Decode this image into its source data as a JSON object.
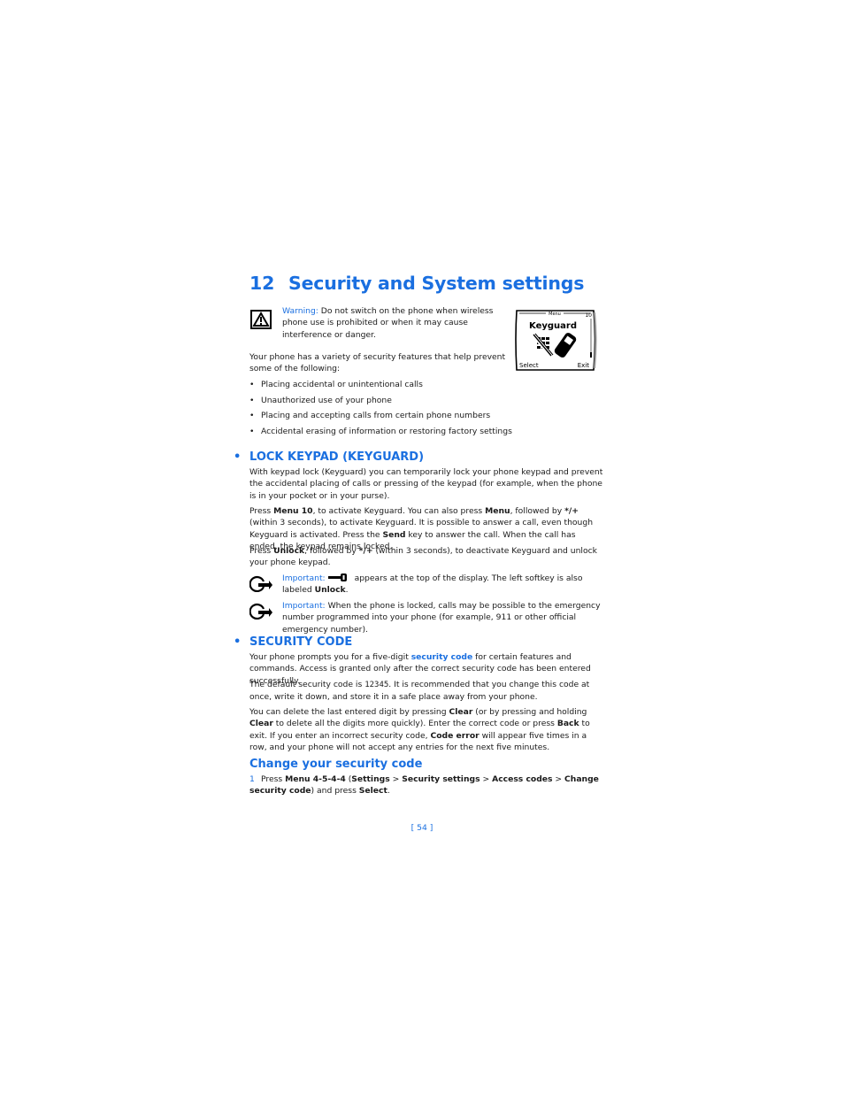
{
  "chapter": {
    "number": "12",
    "title": "Security and System settings"
  },
  "warning": {
    "icon": "warning-triangle-icon",
    "label": "Warning:",
    "text": " Do not switch on the phone when wireless phone use is prohibited or when it may cause interference or danger."
  },
  "phone_screen": {
    "header": "Menu",
    "index": "10",
    "title": "Keyguard",
    "left_softkey": "Select",
    "right_softkey": "Exit"
  },
  "intro": {
    "text": "Your phone has a variety of security features that help prevent some of the following:",
    "bullets": [
      "Placing accidental or unintentional calls",
      "Unauthorized use of your phone",
      "Placing and accepting calls from certain phone numbers",
      "Accidental erasing of information or restoring factory settings"
    ]
  },
  "lock_keypad": {
    "heading": "LOCK KEYPAD (KEYGUARD)",
    "p1": "With keypad lock (Keyguard) you can temporarily lock your phone keypad and prevent the accidental placing of calls or pressing of the keypad (for example, when the phone is in your pocket or in your purse).",
    "p2": {
      "t1": "Press ",
      "b1": "Menu 10",
      "t2": ", to activate Keyguard. You can also press ",
      "b2": "Menu",
      "t3": ", followed by ",
      "b3": "*/+",
      "t4": " (within 3 seconds), to activate Keyguard. It is possible to answer a call, even though Keyguard is activated. Press the ",
      "b4": "Send",
      "t5": " key to answer the call. When the call has ended, the keypad remains locked."
    },
    "p3": {
      "t1": "Press ",
      "b1": "Unlock",
      "t2": ", followed by ",
      "b2": "*/+",
      "t3": " (within 3 seconds), to deactivate Keyguard and unlock your phone keypad."
    },
    "note1": {
      "label": "Important:",
      "t1": " appears at the top of the display. The left softkey is also labeled ",
      "b1": "Unlock",
      "t2": "."
    },
    "note2": {
      "label": "Important:",
      "text": " When the phone is locked, calls may be possible to the emergency number programmed into your phone (for example, 911 or other official emergency number)."
    }
  },
  "security_code": {
    "heading": "SECURITY CODE",
    "p1": {
      "t1": "Your phone prompts you for a five-digit ",
      "link": "security code",
      "t2": " for certain features and commands. Access is granted only after the correct security code has been entered successfully."
    },
    "p2": {
      "t1": "The default security code is ",
      "code": "12345",
      "t2": ". It is recommended that you change this code at once, write it down, and store it in a safe place away from your phone."
    },
    "p3": {
      "t1": "You can delete the last entered digit by pressing ",
      "b1": "Clear",
      "t2": " (or by pressing and holding ",
      "b2": "Clear",
      "t3": " to delete all the digits more quickly). Enter the correct code or press ",
      "b3": "Back",
      "t4": " to exit. If you enter an incorrect security code, ",
      "b4": "Code error",
      "t5": " will appear five times in a row, and your phone will not accept any entries for the next five minutes."
    }
  },
  "change_code": {
    "heading": "Change your security code",
    "step1": {
      "n": "1",
      "t1": "Press ",
      "b1": "Menu 4-5-4-4",
      "t2": " (",
      "b2": "Settings",
      "t3": " > ",
      "b3": "Security settings",
      "t4": " > ",
      "b4": "Access codes",
      "t5": " > ",
      "b5": "Change security code",
      "t6": ") and press ",
      "b6": "Select",
      "t7": "."
    }
  },
  "footer": {
    "page": "[ 54 ]"
  }
}
